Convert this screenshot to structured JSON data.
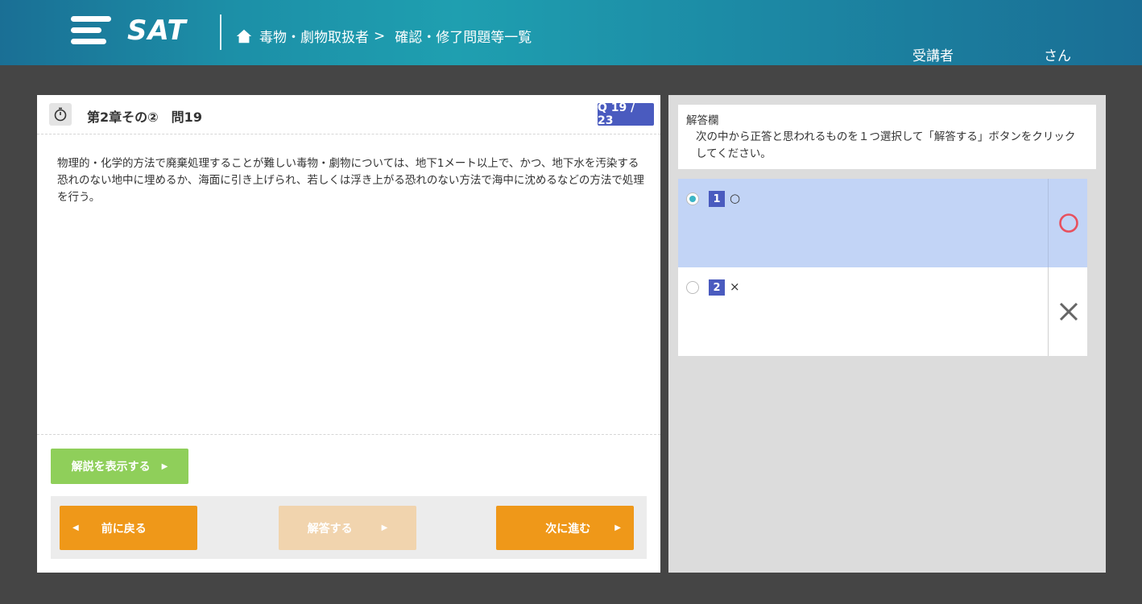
{
  "header": {
    "logo_text": "SAT",
    "breadcrumb": {
      "course": "毒物・劇物取扱者",
      "separator": ">",
      "page": "確認・修了問題等一覧"
    },
    "user_label": "受講者",
    "user_suffix": "さん"
  },
  "question": {
    "title": "第2章その②　問19",
    "counter": "Q 19 / 23",
    "body": "物理的・化学的方法で廃棄処理することが難しい毒物・劇物については、地下1メート以上で、かつ、地下水を汚染する恐れのない地中に埋めるか、海面に引き上げられ、若しくは浮き上がる恐れのない方法で海中に沈めるなどの方法で処理を行う。",
    "explain_button": "解説を表示する",
    "nav": {
      "prev": "前に戻る",
      "answer": "解答する",
      "next": "次に進む"
    }
  },
  "answer_panel": {
    "title": "解答欄",
    "instruction": "次の中から正答と思われるものを１つ選択して「解答する」ボタンをクリックしてください。",
    "choices": [
      {
        "num": "1",
        "text": "○",
        "selected": true,
        "mark": "circle-mark"
      },
      {
        "num": "2",
        "text": "×",
        "selected": false,
        "mark": "cross-mark"
      }
    ]
  },
  "colors": {
    "accent_orange": "#ef9819",
    "badge_blue": "#4a5bbf",
    "explain_green": "#8fcf5a",
    "selected_choice": "#c2d4f6"
  }
}
